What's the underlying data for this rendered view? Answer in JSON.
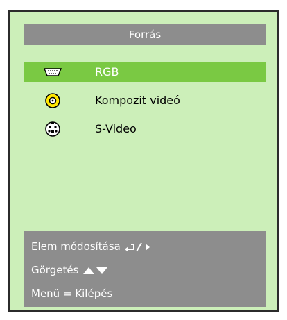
{
  "menu": {
    "title": "Forrás",
    "items": [
      {
        "label": "RGB",
        "icon": "vga-connector-icon",
        "selected": true
      },
      {
        "label": "Kompozit videó",
        "icon": "composite-rca-icon",
        "selected": false
      },
      {
        "label": "S-Video",
        "icon": "svideo-connector-icon",
        "selected": false
      }
    ]
  },
  "footer": {
    "modify_label": "Elem módosítása",
    "scroll_label": "Görgetés",
    "exit_label": "Menü = Kilépés"
  },
  "colors": {
    "panel_bg": "#ccefb9",
    "bar_gray": "#8d8d8d",
    "selected_green": "#7ac943",
    "composite_yellow": "#ffe600"
  }
}
